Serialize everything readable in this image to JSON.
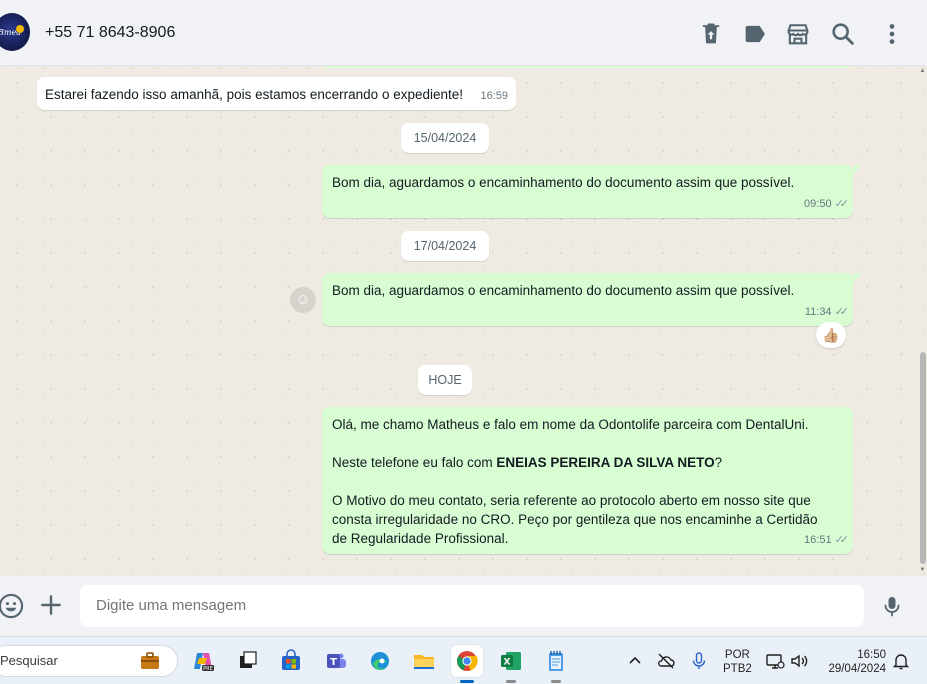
{
  "header": {
    "contact_name": "+55 71 8643-8906",
    "avatar_text": "Bmed",
    "icons": [
      "delete-icon",
      "label-icon",
      "store-icon",
      "search-icon",
      "menu-icon"
    ]
  },
  "messages": [
    {
      "direction": "in",
      "text": "Estarei fazendo isso amanhã, pois estamos encerrando o expediente!",
      "time": "16:59"
    },
    {
      "type": "date",
      "label": "15/04/2024"
    },
    {
      "direction": "out",
      "text": "Bom dia, aguardamos o encaminhamento do documento assim que possível.",
      "time": "09:50",
      "status": "read"
    },
    {
      "type": "date",
      "label": "17/04/2024"
    },
    {
      "direction": "out",
      "text": "Bom dia, aguardamos o encaminhamento do documento assim que possível.",
      "time": "11:34",
      "status": "read",
      "reaction": "👍🏼"
    },
    {
      "type": "date",
      "label": "HOJE"
    },
    {
      "direction": "out",
      "time": "16:51",
      "status": "read",
      "para1": "Olá, me chamo Matheus e falo em nome da Odontolife parceira com DentalUni.",
      "para2_prefix": "Neste telefone eu falo com ",
      "para2_bold": "ENEIAS PEREIRA DA SILVA NETO",
      "para2_suffix": "?",
      "para3": "O Motivo do meu contato, seria referente ao protocolo aberto em nosso site que consta irregularidade no CRO. Peço por gentileza que nos encaminhe a Certidão de Regularidade Profissional."
    }
  ],
  "composer": {
    "placeholder": "Digite uma mensagem"
  },
  "taskbar": {
    "search_text": "Pesquisar",
    "lang_line1": "POR",
    "lang_line2": "PTB2",
    "time": "16:50",
    "date": "29/04/2024",
    "apps": [
      "briefcase-icon",
      "copilot-icon",
      "task-view-icon",
      "store-icon",
      "teams-icon",
      "edge-icon",
      "file-explorer-icon",
      "chrome-icon",
      "excel-icon",
      "notepad-icon"
    ]
  },
  "colors": {
    "outgoing_bubble": "#d9fdd3",
    "incoming_bubble": "#ffffff",
    "chat_background": "#efeae2",
    "header_background": "#f0f2f5"
  }
}
